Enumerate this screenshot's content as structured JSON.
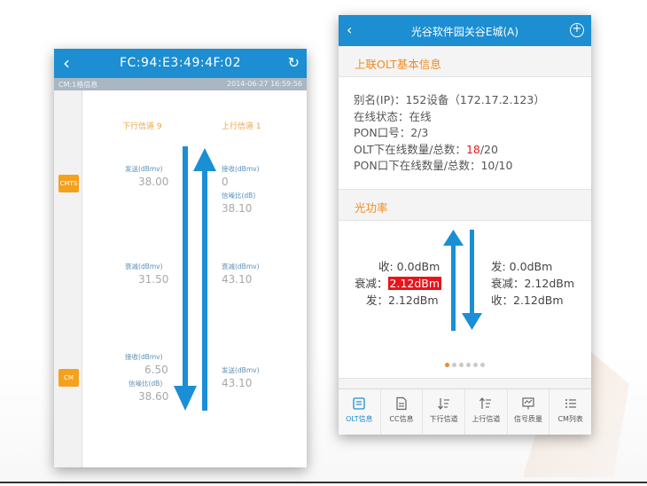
{
  "left_screen": {
    "title": "FC:94:E3:49:4F:02",
    "subbar_left": "CM:1格信息",
    "subbar_right": "2014-06-27 16:59:56",
    "badges": {
      "cmts": "CMTS",
      "cm": "CM"
    },
    "downstream_header": "下行信道 9",
    "upstream_header": "上行信道 1",
    "down": {
      "send_label": "发送(dBmv)",
      "send_value": "38.00",
      "atten_label": "衰减(dBmv)",
      "atten_value": "31.50",
      "recv_label": "接收(dBmv)",
      "recv_value": "6.50",
      "snr_label": "信噪比(dB)",
      "snr_value": "38.60"
    },
    "up": {
      "recv_label": "接收(dBmv)",
      "recv_value": "0",
      "snr_label": "信噪比(dB)",
      "snr_value": "38.10",
      "atten_label": "衰减(dBmv)",
      "atten_value": "43.10",
      "send_label": "发送(dBmv)",
      "send_value": "43.10"
    }
  },
  "right_screen": {
    "title": "光谷软件园关谷E城(A)",
    "basic_section": "上联OLT基本信息",
    "info": {
      "alias": "别名(IP)：152设备（172.17.2.123）",
      "status": "在线状态：在线",
      "pon": "PON口号：2/3",
      "olt_prefix": "OLT下在线数量/总数：",
      "olt_online": "18",
      "olt_total": "/20",
      "pon_online": "PON口下在线数量/总数：10/10"
    },
    "power_section": "光功率",
    "power": {
      "left_recv": "收: 0.0dBm",
      "left_atten_label": "衰减：",
      "left_atten_value": "2.12dBm",
      "left_send": "发：2.12dBm",
      "right_send": "发: 0.0dBm",
      "right_atten": "衰减：2.12dBm",
      "right_recv": "收：2.12dBm"
    },
    "pager": {
      "count": 6,
      "active": 0
    },
    "tabs": [
      {
        "label": "OLT信息",
        "icon": "olt-info-icon",
        "active": true
      },
      {
        "label": "CC信息",
        "icon": "document-icon",
        "active": false
      },
      {
        "label": "下行信道",
        "icon": "downstream-sort-icon",
        "active": false
      },
      {
        "label": "上行信道",
        "icon": "upstream-sort-icon",
        "active": false
      },
      {
        "label": "信号质量",
        "icon": "signal-quality-icon",
        "active": false
      },
      {
        "label": "CM列表",
        "icon": "list-icon",
        "active": false
      }
    ]
  },
  "colors": {
    "topbar": "#1c8ed1",
    "accent_orange": "#f08a24",
    "arrow_blue": "#1a8fd6",
    "badge_orange": "#f5a11c",
    "alert_red": "#e8141b"
  }
}
